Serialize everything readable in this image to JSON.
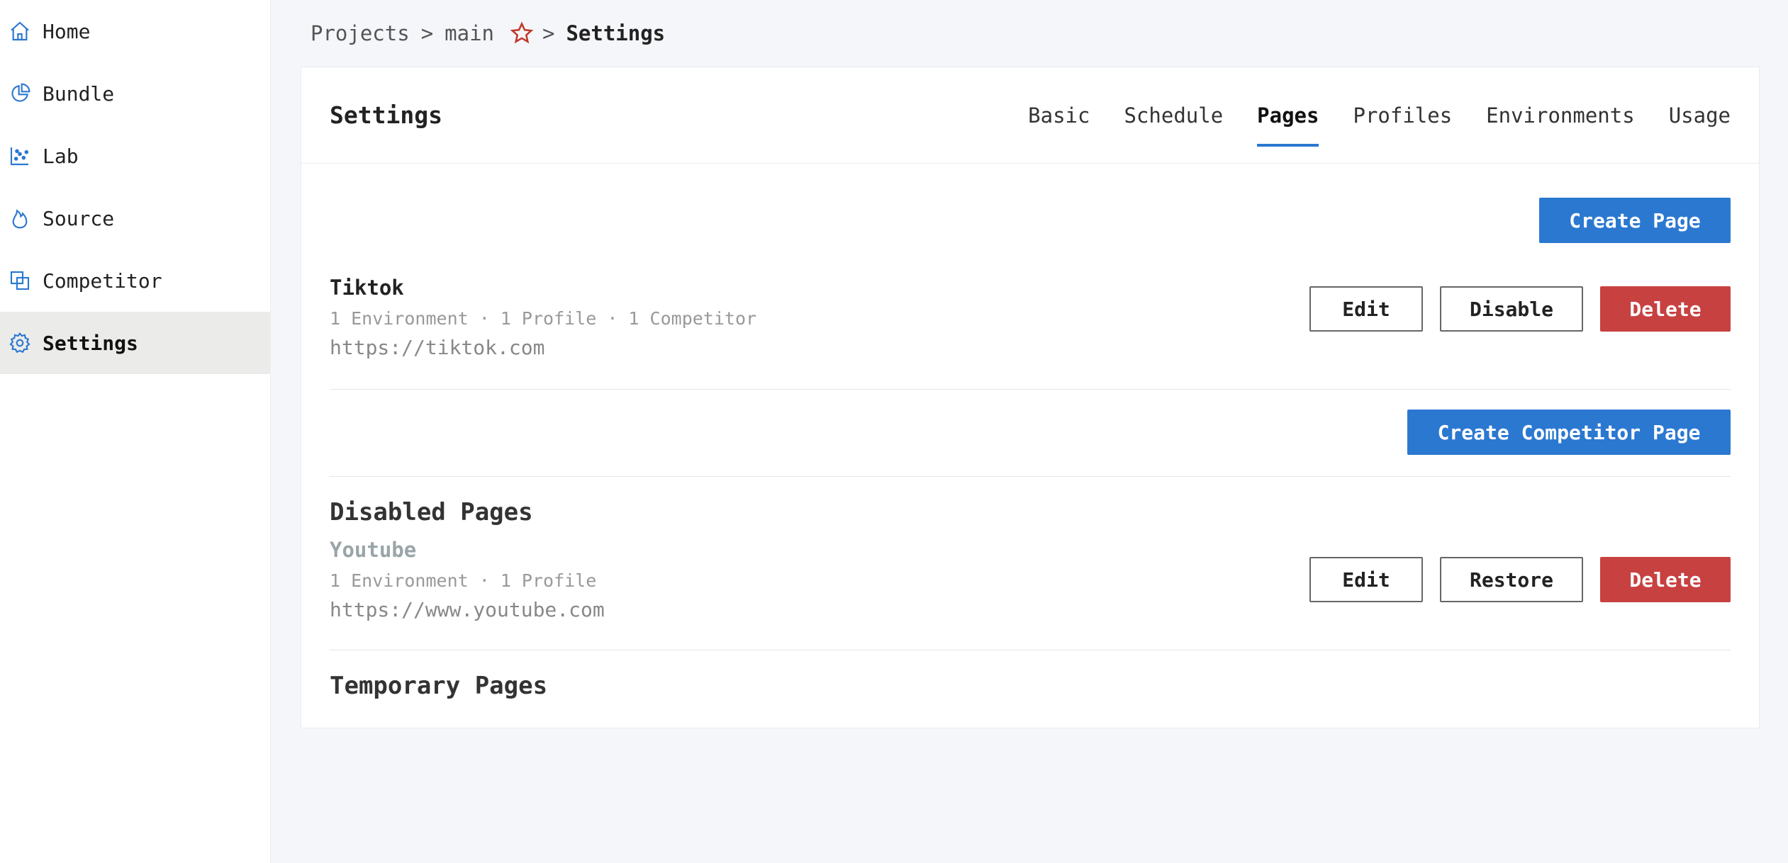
{
  "sidebar": {
    "items": [
      {
        "label": "Home",
        "icon": "home-icon"
      },
      {
        "label": "Bundle",
        "icon": "pie-chart-icon"
      },
      {
        "label": "Lab",
        "icon": "scatter-chart-icon"
      },
      {
        "label": "Source",
        "icon": "flame-icon"
      },
      {
        "label": "Competitor",
        "icon": "overlap-squares-icon"
      },
      {
        "label": "Settings",
        "icon": "gear-icon",
        "active": true
      }
    ]
  },
  "breadcrumb": {
    "projects": "Projects",
    "separator": ">",
    "project": "main",
    "current": "Settings"
  },
  "header": {
    "title": "Settings",
    "tabs": [
      {
        "label": "Basic"
      },
      {
        "label": "Schedule"
      },
      {
        "label": "Pages",
        "active": true
      },
      {
        "label": "Profiles"
      },
      {
        "label": "Environments"
      },
      {
        "label": "Usage"
      }
    ]
  },
  "pages": {
    "create_page_label": "Create Page",
    "active": [
      {
        "name": "Tiktok",
        "meta": "1 Environment · 1 Profile · 1 Competitor",
        "url": "https://tiktok.com",
        "edit_label": "Edit",
        "disable_label": "Disable",
        "delete_label": "Delete"
      }
    ],
    "create_competitor_label": "Create Competitor Page",
    "disabled_title": "Disabled Pages",
    "disabled": [
      {
        "name": "Youtube",
        "meta": "1 Environment · 1 Profile",
        "url": "https://www.youtube.com",
        "edit_label": "Edit",
        "restore_label": "Restore",
        "delete_label": "Delete"
      }
    ],
    "temporary_title": "Temporary Pages"
  },
  "colors": {
    "accent": "#2b78d1",
    "danger": "#c84141",
    "star": "#c0392b",
    "sidebar_active_bg": "#ebebea"
  }
}
